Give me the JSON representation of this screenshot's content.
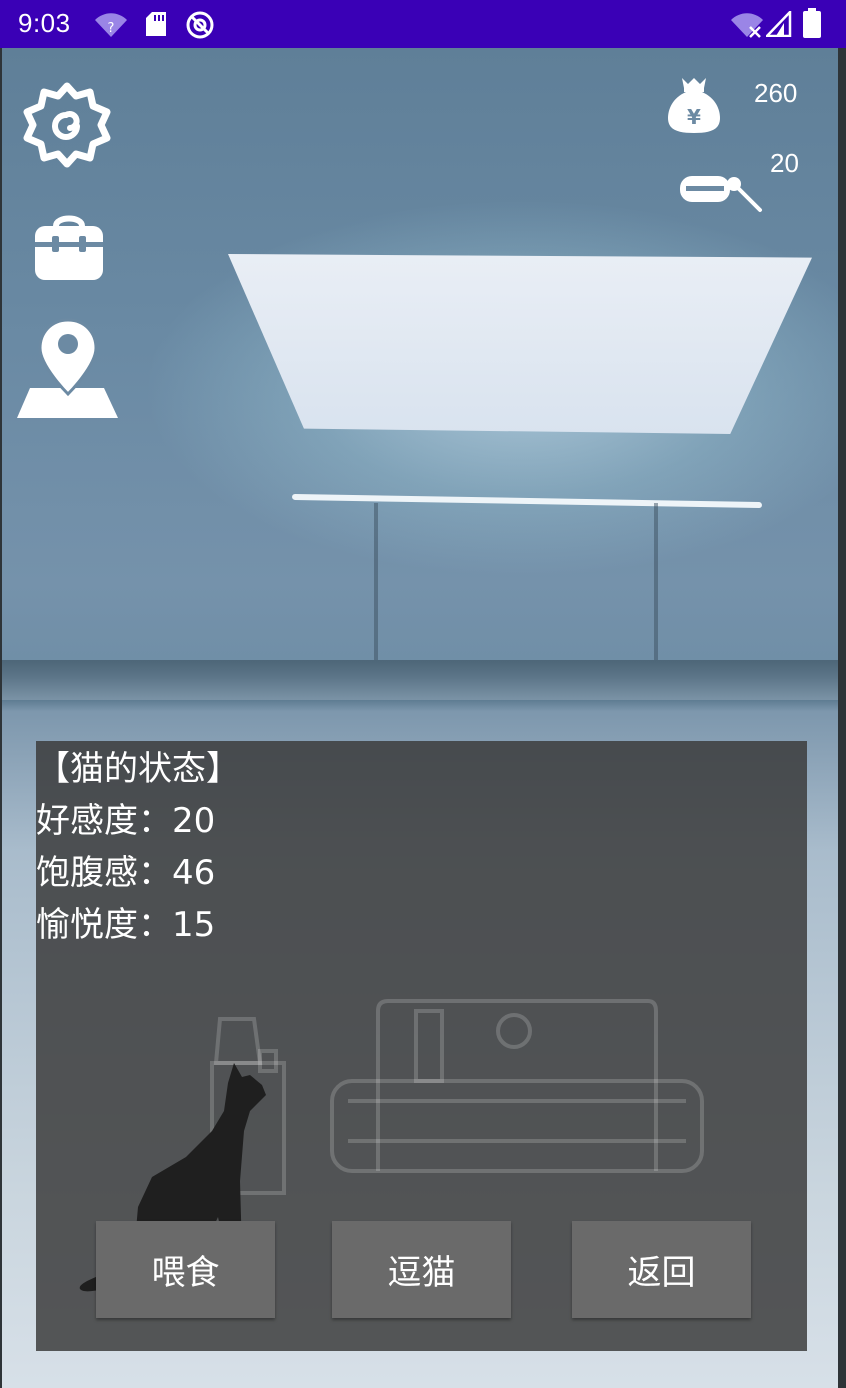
{
  "status_bar": {
    "time": "9:03",
    "left_icons": [
      "wifi-question-icon",
      "sd-card-icon",
      "no-sim-icon"
    ],
    "right_icons": [
      "wifi-off-icon",
      "signal-icon",
      "battery-icon"
    ],
    "wifi_unknown_mark": "?"
  },
  "toolbar": {
    "left_icons": [
      "gear-icon",
      "backpack-icon",
      "map-pin-icon"
    ],
    "money_icon": "money-bag-icon",
    "money_symbol": "¥",
    "money_value": "260",
    "toy_icon": "cat-toy-icon",
    "toy_value": "20"
  },
  "cat_status": {
    "title": "【猫的状态】",
    "rows": [
      {
        "label": "好感度：",
        "value": "20"
      },
      {
        "label": "饱腹感：",
        "value": "46"
      },
      {
        "label": "愉悦度：",
        "value": "15"
      }
    ]
  },
  "actions": {
    "feed_label": "喂食",
    "play_label": "逗猫",
    "back_label": "返回"
  },
  "colors": {
    "status_bar": "#3a00b6",
    "panel": "#3a3a3a",
    "button": "#6a6a6a"
  }
}
